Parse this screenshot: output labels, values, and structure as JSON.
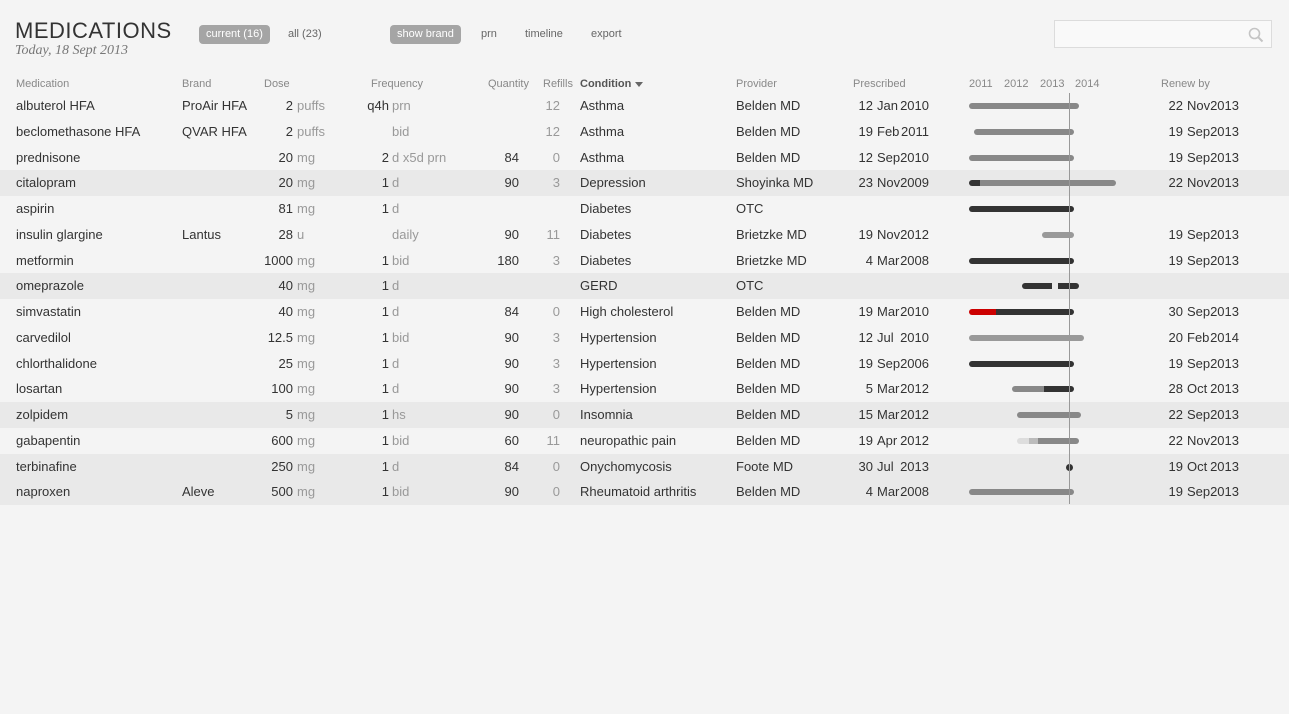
{
  "header": {
    "title": "MEDICATIONS",
    "subtitle": "Today, 18 Sept 2013"
  },
  "filters": {
    "current": "current (16)",
    "all": "all (23)",
    "show_brand": "show brand",
    "prn": "prn",
    "timeline": "timeline",
    "export": "export"
  },
  "search": {
    "placeholder": ""
  },
  "columns": {
    "medication": "Medication",
    "brand": "Brand",
    "dose": "Dose",
    "frequency": "Frequency",
    "quantity": "Quantity",
    "refills": "Refills",
    "condition": "Condition",
    "provider": "Provider",
    "prescribed": "Prescribed",
    "years": [
      "2011",
      "2012",
      "2013",
      "2014"
    ],
    "renew": "Renew by"
  },
  "rows": [
    {
      "med": "albuterol HFA",
      "brand": "ProAir HFA",
      "dose": "2",
      "unit": "puffs",
      "f1": "q4h",
      "f2": "prn",
      "qty": "",
      "refills": "12",
      "condition": "Asthma",
      "provider": "Belden MD",
      "pd": "12",
      "pm": "Jan",
      "py": "2010",
      "rd": "22",
      "rm": "Nov",
      "ry": "2013",
      "shade": false,
      "bars": [
        {
          "s": 2010.85,
          "e": 2013.95,
          "c": "#888"
        }
      ],
      "dot": false
    },
    {
      "med": "beclomethasone HFA",
      "brand": "QVAR HFA",
      "dose": "2",
      "unit": "puffs",
      "f1": "",
      "f2": "bid",
      "qty": "",
      "refills": "12",
      "condition": "Asthma",
      "provider": "Belden MD",
      "pd": "19",
      "pm": "Feb",
      "py": "2011",
      "rd": "19",
      "rm": "Sep",
      "ry": "2013",
      "shade": false,
      "bars": [
        {
          "s": 2011.0,
          "e": 2013.8,
          "c": "#888"
        }
      ],
      "dot": false
    },
    {
      "med": "prednisone",
      "brand": "",
      "dose": "20",
      "unit": "mg",
      "f1": "2",
      "f2": "d x5d prn",
      "qty": "84",
      "refills": "0",
      "condition": "Asthma",
      "provider": "Belden MD",
      "pd": "12",
      "pm": "Sep",
      "py": "2010",
      "rd": "19",
      "rm": "Sep",
      "ry": "2013",
      "shade": false,
      "bars": [
        {
          "s": 2010.85,
          "e": 2013.8,
          "c": "#888"
        }
      ],
      "dot": false
    },
    {
      "med": "citalopram",
      "brand": "",
      "dose": "20",
      "unit": "mg",
      "f1": "1",
      "f2": "d",
      "qty": "90",
      "refills": "3",
      "condition": "Depression",
      "provider": "Shoyinka MD",
      "pd": "23",
      "pm": "Nov",
      "py": "2009",
      "rd": "22",
      "rm": "Nov",
      "ry": "2013",
      "shade": true,
      "bars": [
        {
          "s": 2010.85,
          "e": 2011.15,
          "c": "#333"
        },
        {
          "s": 2011.15,
          "e": 2015.0,
          "c": "#888"
        }
      ],
      "dot": false
    },
    {
      "med": "aspirin",
      "brand": "",
      "dose": "81",
      "unit": "mg",
      "f1": "1",
      "f2": "d",
      "qty": "",
      "refills": "",
      "condition": "Diabetes",
      "provider": "OTC",
      "pd": "",
      "pm": "",
      "py": "",
      "rd": "",
      "rm": "",
      "ry": "",
      "shade": false,
      "bars": [
        {
          "s": 2010.85,
          "e": 2013.8,
          "c": "#333"
        }
      ],
      "dot": false
    },
    {
      "med": "insulin glargine",
      "brand": "Lantus",
      "dose": "28",
      "unit": "u",
      "f1": "",
      "f2": "daily",
      "qty": "90",
      "refills": "11",
      "condition": "Diabetes",
      "provider": "Brietzke MD",
      "pd": "19",
      "pm": "Nov",
      "py": "2012",
      "rd": "19",
      "rm": "Sep",
      "ry": "2013",
      "shade": false,
      "bars": [
        {
          "s": 2012.9,
          "e": 2013.8,
          "c": "#999"
        }
      ],
      "dot": false
    },
    {
      "med": "metformin",
      "brand": "",
      "dose": "1000",
      "unit": "mg",
      "f1": "1",
      "f2": "bid",
      "qty": "180",
      "refills": "3",
      "condition": "Diabetes",
      "provider": "Brietzke MD",
      "pd": "4",
      "pm": "Mar",
      "py": "2008",
      "rd": "19",
      "rm": "Sep",
      "ry": "2013",
      "shade": false,
      "bars": [
        {
          "s": 2010.85,
          "e": 2013.8,
          "c": "#333"
        }
      ],
      "dot": false
    },
    {
      "med": "omeprazole",
      "brand": "",
      "dose": "40",
      "unit": "mg",
      "f1": "1",
      "f2": "d",
      "qty": "",
      "refills": "",
      "condition": "GERD",
      "provider": "OTC",
      "pd": "",
      "pm": "",
      "py": "",
      "rd": "",
      "rm": "",
      "ry": "",
      "shade": true,
      "bars": [
        {
          "s": 2012.35,
          "e": 2013.2,
          "c": "#333"
        },
        {
          "s": 2013.35,
          "e": 2013.95,
          "c": "#333"
        }
      ],
      "dot": false
    },
    {
      "med": "simvastatin",
      "brand": "",
      "dose": "40",
      "unit": "mg",
      "f1": "1",
      "f2": "d",
      "qty": "84",
      "refills": "0",
      "condition": "High cholesterol",
      "provider": "Belden MD",
      "pd": "19",
      "pm": "Mar",
      "py": "2010",
      "rd": "30",
      "rm": "Sep",
      "ry": "2013",
      "shade": false,
      "bars": [
        {
          "s": 2010.85,
          "e": 2011.6,
          "c": "#c00"
        },
        {
          "s": 2011.6,
          "e": 2013.8,
          "c": "#333"
        }
      ],
      "dot": false
    },
    {
      "med": "carvedilol",
      "brand": "",
      "dose": "12.5",
      "unit": "mg",
      "f1": "1",
      "f2": "bid",
      "qty": "90",
      "refills": "3",
      "condition": "Hypertension",
      "provider": "Belden MD",
      "pd": "12",
      "pm": "Jul",
      "py": "2010",
      "rd": "20",
      "rm": "Feb",
      "ry": "2014",
      "shade": false,
      "bars": [
        {
          "s": 2010.85,
          "e": 2014.1,
          "c": "#999"
        }
      ],
      "dot": false
    },
    {
      "med": "chlorthalidone",
      "brand": "",
      "dose": "25",
      "unit": "mg",
      "f1": "1",
      "f2": "d",
      "qty": "90",
      "refills": "3",
      "condition": "Hypertension",
      "provider": "Belden MD",
      "pd": "19",
      "pm": "Sep",
      "py": "2006",
      "rd": "19",
      "rm": "Sep",
      "ry": "2013",
      "shade": false,
      "bars": [
        {
          "s": 2010.85,
          "e": 2013.8,
          "c": "#333"
        }
      ],
      "dot": false
    },
    {
      "med": "losartan",
      "brand": "",
      "dose": "100",
      "unit": "mg",
      "f1": "1",
      "f2": "d",
      "qty": "90",
      "refills": "3",
      "condition": "Hypertension",
      "provider": "Belden MD",
      "pd": "5",
      "pm": "Mar",
      "py": "2012",
      "rd": "28",
      "rm": "Oct",
      "ry": "2013",
      "shade": false,
      "bars": [
        {
          "s": 2012.05,
          "e": 2012.95,
          "c": "#888"
        },
        {
          "s": 2012.95,
          "e": 2013.8,
          "c": "#333"
        }
      ],
      "dot": false
    },
    {
      "med": "zolpidem",
      "brand": "",
      "dose": "5",
      "unit": "mg",
      "f1": "1",
      "f2": "hs",
      "qty": "90",
      "refills": "0",
      "condition": "Insomnia",
      "provider": "Belden MD",
      "pd": "15",
      "pm": "Mar",
      "py": "2012",
      "rd": "22",
      "rm": "Sep",
      "ry": "2013",
      "shade": true,
      "bars": [
        {
          "s": 2012.2,
          "e": 2014.0,
          "c": "#888"
        }
      ],
      "dot": false
    },
    {
      "med": "gabapentin",
      "brand": "",
      "dose": "600",
      "unit": "mg",
      "f1": "1",
      "f2": "bid",
      "qty": "60",
      "refills": "11",
      "condition": "neuropathic pain",
      "provider": "Belden MD",
      "pd": "19",
      "pm": "Apr",
      "py": "2012",
      "rd": "22",
      "rm": "Nov",
      "ry": "2013",
      "shade": false,
      "bars": [
        {
          "s": 2012.2,
          "e": 2012.55,
          "c": "#ddd"
        },
        {
          "s": 2012.55,
          "e": 2012.8,
          "c": "#bbb"
        },
        {
          "s": 2012.8,
          "e": 2013.95,
          "c": "#888"
        }
      ],
      "dot": false
    },
    {
      "med": "terbinafine",
      "brand": "",
      "dose": "250",
      "unit": "mg",
      "f1": "1",
      "f2": "d",
      "qty": "84",
      "refills": "0",
      "condition": "Onychomycosis",
      "provider": "Foote MD",
      "pd": "30",
      "pm": "Jul",
      "py": "2013",
      "rd": "19",
      "rm": "Oct",
      "ry": "2013",
      "shade": true,
      "bars": [],
      "dot": true
    },
    {
      "med": "naproxen",
      "brand": "Aleve",
      "dose": "500",
      "unit": "mg",
      "f1": "1",
      "f2": "bid",
      "qty": "90",
      "refills": "0",
      "condition": "Rheumatoid arthritis",
      "provider": "Belden MD",
      "pd": "4",
      "pm": "Mar",
      "py": "2008",
      "rd": "19",
      "rm": "Sep",
      "ry": "2013",
      "shade": true,
      "bars": [
        {
          "s": 2010.85,
          "e": 2013.8,
          "c": "#888"
        }
      ],
      "dot": false
    }
  ]
}
